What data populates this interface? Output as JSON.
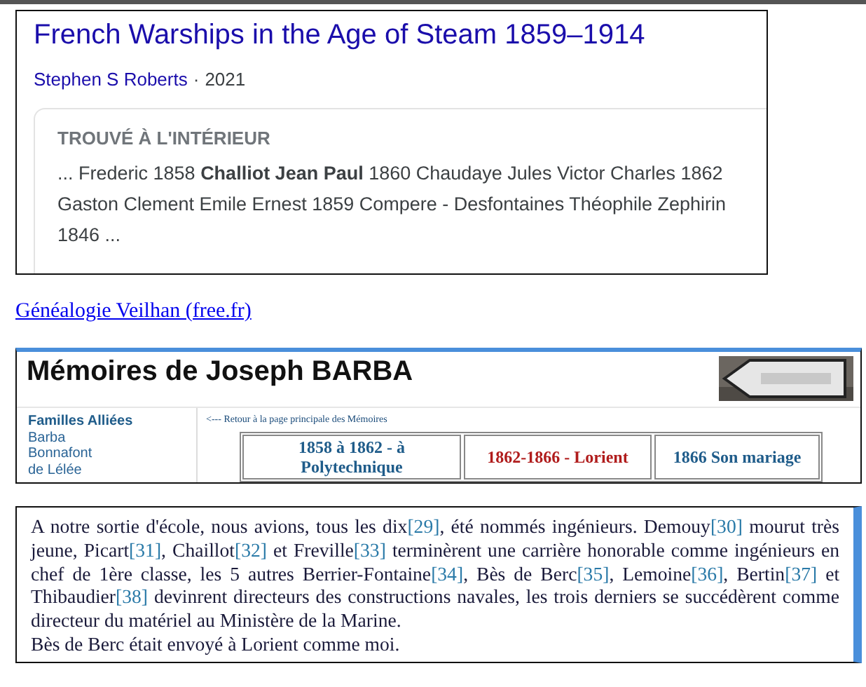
{
  "book_result": {
    "title": "French Warships in the Age of Steam 1859–1914",
    "author": "Stephen S Roberts",
    "separator": "·",
    "year": "2021",
    "excerpt": {
      "heading": "TROUVÉ À L'INTÉRIEUR",
      "text": "... Frederic 1858 **Challiot Jean Paul** 1860 Chaudaye Jules Victor Charles 1862 Gaston Clement Emile Ernest 1859 Compere - Desfontaines Théophile Zephirin 1846 ..."
    }
  },
  "source_link": "Généalogie Veilhan (free.fr)",
  "site_preview": {
    "title": "Mémoires de Joseph BARBA",
    "sidebar": {
      "heading": "Familles Alliées",
      "items": [
        "Barba",
        "Bonnafont",
        "de Lélée"
      ]
    },
    "back_link": "<--- Retour à la page principale des Mémoires",
    "tabs": [
      {
        "label": "1858 à 1862 - à Polytechnique",
        "selected": false
      },
      {
        "label": "1862-1866 - Lorient",
        "selected": true
      },
      {
        "label": "1866 Son mariage",
        "selected": false
      }
    ]
  },
  "memoir_text": {
    "paragraphs": [
      [
        {
          "kind": "text",
          "text": "A notre sortie d'école, nous avions, tous les dix"
        },
        {
          "kind": "ref",
          "text": "[29]"
        },
        {
          "kind": "text",
          "text": ", été nommés ingénieurs. Demouy"
        },
        {
          "kind": "ref",
          "text": "[30]"
        },
        {
          "kind": "text",
          "text": " mourut très jeune, Picart"
        },
        {
          "kind": "ref",
          "text": "[31]"
        },
        {
          "kind": "text",
          "text": ", Chaillot"
        },
        {
          "kind": "ref",
          "text": "[32]"
        },
        {
          "kind": "text",
          "text": " et Freville"
        },
        {
          "kind": "ref",
          "text": "[33]"
        },
        {
          "kind": "text",
          "text": " terminèrent une carrière honorable comme ingénieurs en chef de 1ère classe, les 5 autres Berrier-Fontaine"
        },
        {
          "kind": "ref",
          "text": "[34]"
        },
        {
          "kind": "text",
          "text": ", Bès de Berc"
        },
        {
          "kind": "ref",
          "text": "[35]"
        },
        {
          "kind": "text",
          "text": ", Lemoine"
        },
        {
          "kind": "ref",
          "text": "[36]"
        },
        {
          "kind": "text",
          "text": ", Bertin"
        },
        {
          "kind": "ref",
          "text": "[37]"
        },
        {
          "kind": "text",
          "text": " et Thibaudier"
        },
        {
          "kind": "ref",
          "text": "[38]"
        },
        {
          "kind": "text",
          "text": " devinrent directeurs des constructions navales, les trois derniers se succédèrent comme directeur du matériel au Ministère de la Marine."
        }
      ],
      [
        {
          "kind": "text",
          "text": "Bès de Berc était envoyé à Lorient comme moi."
        }
      ]
    ]
  }
}
